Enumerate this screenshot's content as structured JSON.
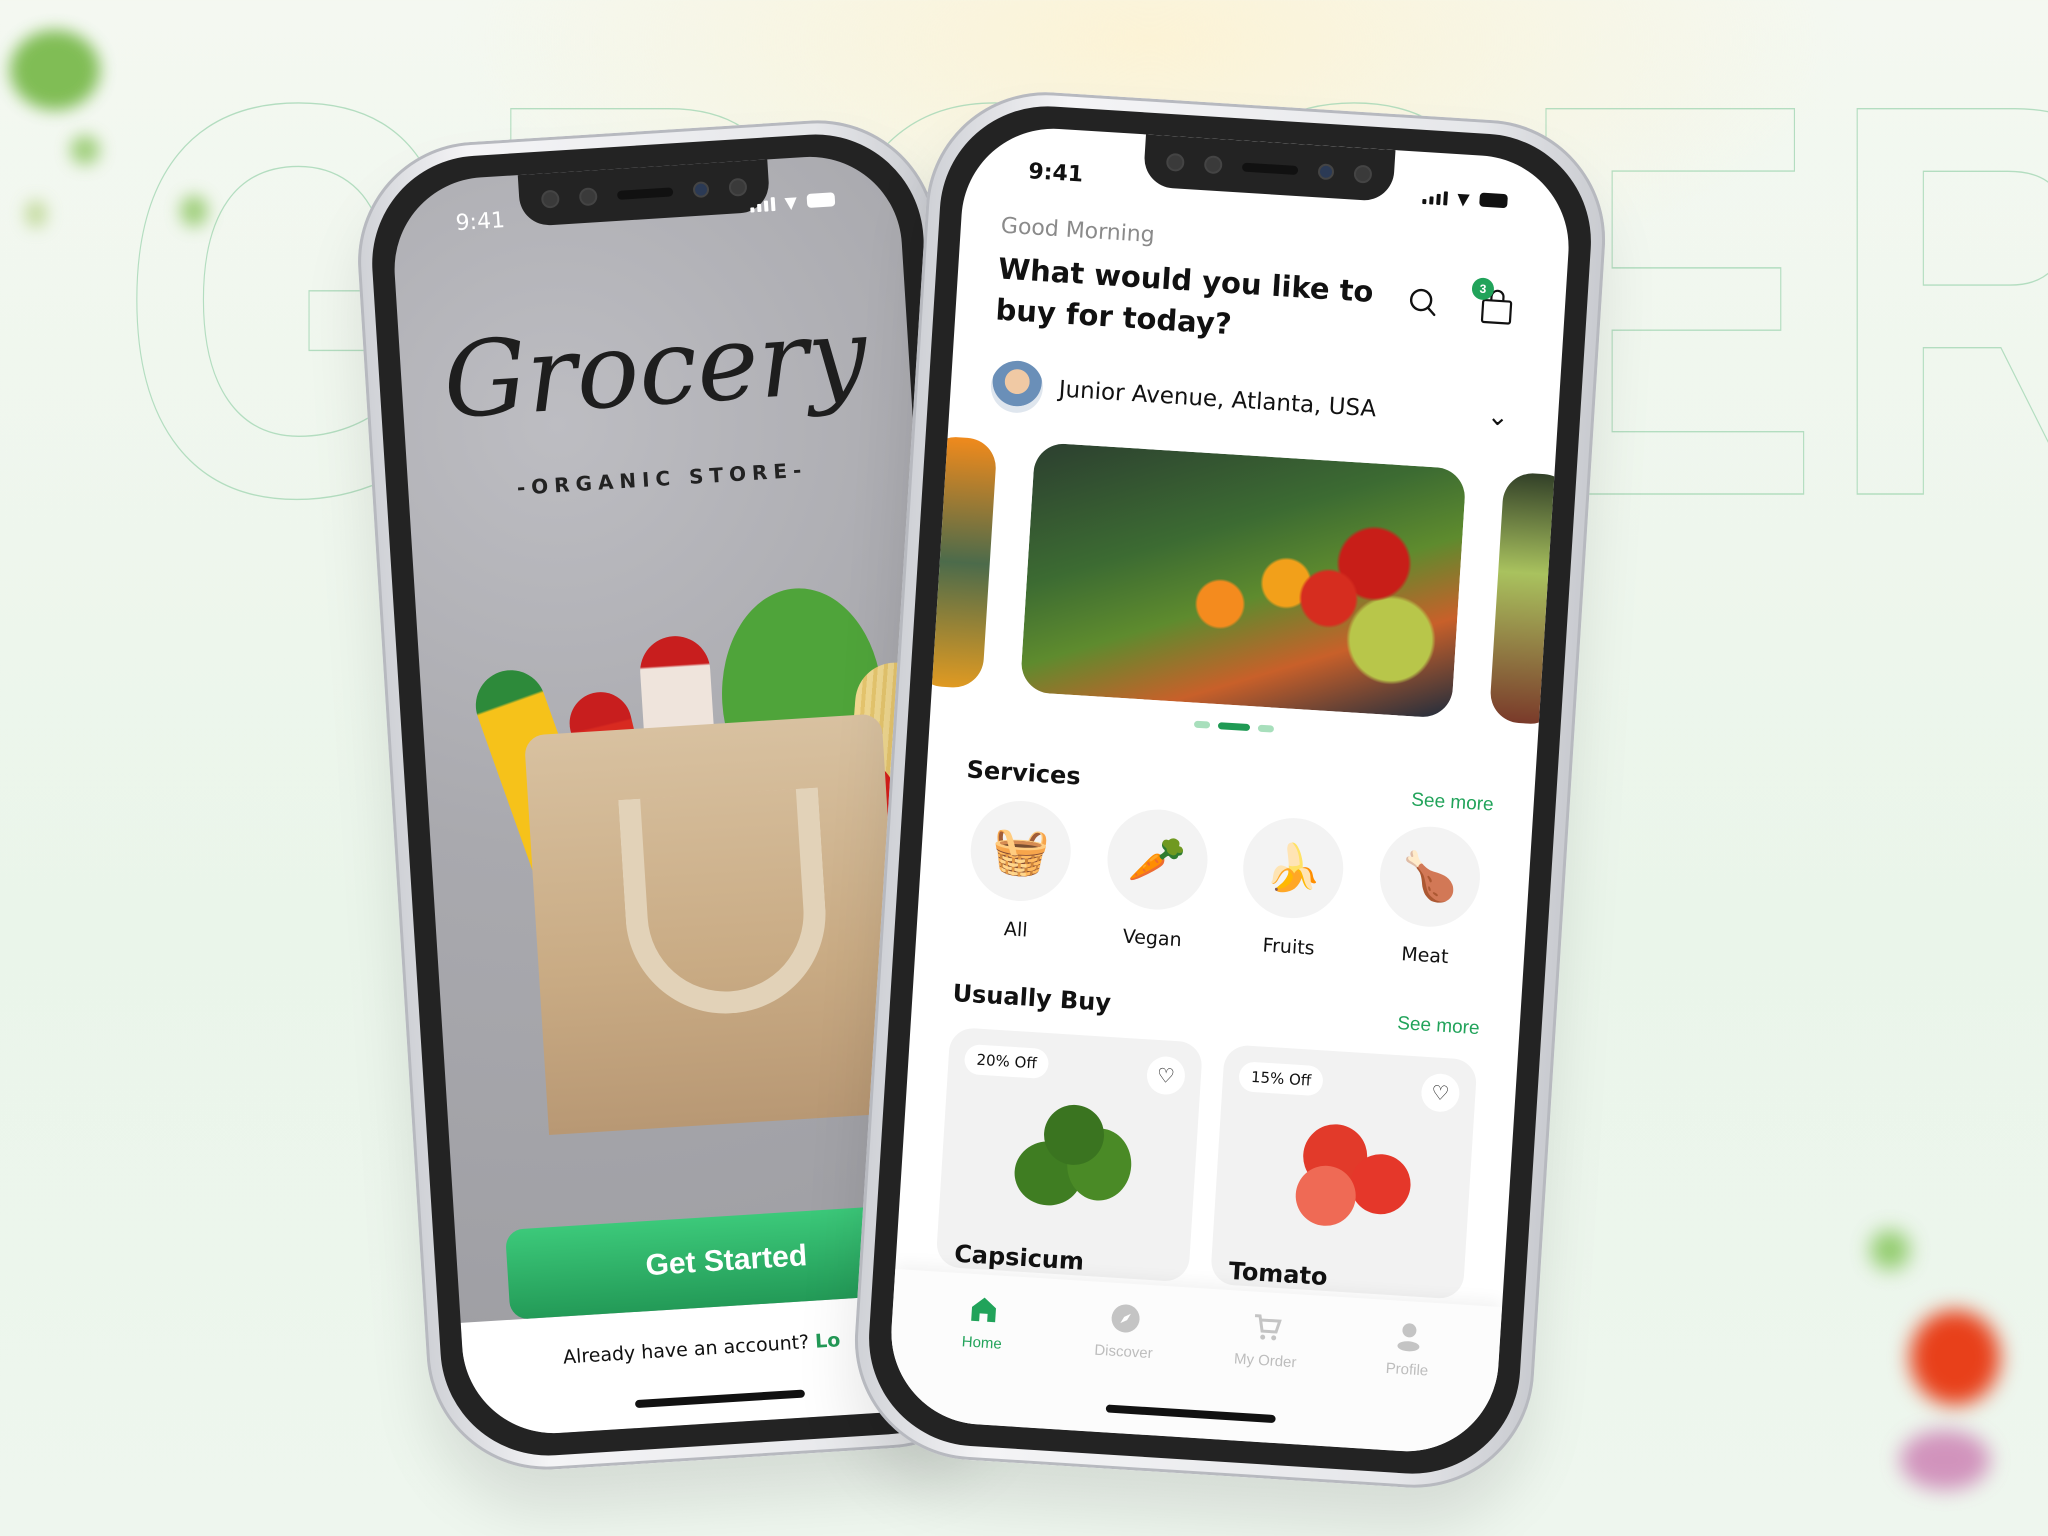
{
  "background": {
    "wordmark": "GROCERY",
    "accent_color": "#21a35a",
    "outline_color": "#a9d9b8"
  },
  "splash_screen": {
    "status_bar": {
      "time": "9:41"
    },
    "logo": "Grocery",
    "tagline": "-ORGANIC STORE-",
    "get_started_label": "Get Started",
    "account_prompt": "Already have an account?",
    "login_link": "Lo"
  },
  "home_screen": {
    "status_bar": {
      "time": "9:41"
    },
    "greeting": "Good Morning",
    "headline": "What would you like to buy for today?",
    "icons": {
      "search": "search-icon",
      "cart": "shopping-bag-icon"
    },
    "cart_count": "3",
    "location": "Junior Avenue, Atlanta, USA",
    "carousel": {
      "slide_count": 3,
      "active_index": 1
    },
    "services": {
      "title": "Services",
      "see_more": "See more",
      "items": [
        {
          "label": "All",
          "icon": "🧺"
        },
        {
          "label": "Vegan",
          "icon": "🥕"
        },
        {
          "label": "Fruits",
          "icon": "🍌"
        },
        {
          "label": "Meat",
          "icon": "🍗"
        }
      ]
    },
    "usually_buy": {
      "title": "Usually Buy",
      "see_more": "See more",
      "products": [
        {
          "name": "Capsicum",
          "discount": "20% Off"
        },
        {
          "name": "Tomato",
          "discount": "15% Off"
        }
      ]
    },
    "tabbar": [
      {
        "label": "Home",
        "icon": "home-icon",
        "active": true
      },
      {
        "label": "Discover",
        "icon": "compass-icon",
        "active": false
      },
      {
        "label": "My Order",
        "icon": "cart-icon",
        "active": false
      },
      {
        "label": "Profile",
        "icon": "user-icon",
        "active": false
      }
    ]
  }
}
